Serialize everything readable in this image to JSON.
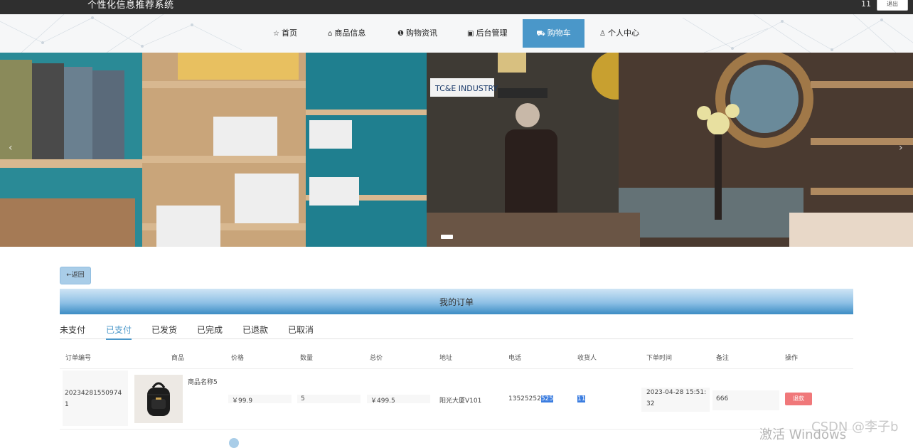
{
  "topbar": {
    "site_title": "个性化信息推荐系统",
    "user": "11",
    "logout_label": "退出"
  },
  "nav": {
    "items": [
      {
        "label": "首页",
        "icon": "star-icon",
        "glyph": "☆"
      },
      {
        "label": "商品信息",
        "icon": "bag-icon",
        "glyph": "⌂"
      },
      {
        "label": "购物资讯",
        "icon": "info-icon",
        "glyph": "❶"
      },
      {
        "label": "后台管理",
        "icon": "gift-icon",
        "glyph": "▣"
      },
      {
        "label": "购物车",
        "icon": "cart-icon",
        "glyph": "⛟"
      },
      {
        "label": "个人中心",
        "icon": "user-icon",
        "glyph": "♙"
      }
    ],
    "active_index": 4,
    "active_color": "#4a97c9"
  },
  "banner": {
    "shop_sign": "TC&E INDUSTRY",
    "prev_glyph": "‹",
    "next_glyph": "›"
  },
  "back_label": "←返回",
  "panel_title": "我的订单",
  "tabs": {
    "items": [
      "未支付",
      "已支付",
      "已发货",
      "已完成",
      "已退款",
      "已取消"
    ],
    "active_index": 1
  },
  "table": {
    "headers": [
      "订单编号",
      "商品",
      "价格",
      "数量",
      "总价",
      "地址",
      "电话",
      "收货人",
      "下单时间",
      "备注",
      "操作"
    ],
    "rows": [
      {
        "order_no_line1": "20234281550974",
        "order_no_line2": "1",
        "product_name": "商品名称5",
        "price": "￥99.9",
        "quantity": "5",
        "total": "￥499.5",
        "address": "阳光大厦V101",
        "phone_plain": "13525252",
        "phone_selected": "525",
        "receiver": "11",
        "time_line1": "2023-04-28 15:51:",
        "time_line2": "32",
        "remark": "666",
        "action_label": "退款"
      }
    ]
  },
  "watermark": {
    "activate": "激活 Windows",
    "csdn": "CSDN @李子b"
  }
}
